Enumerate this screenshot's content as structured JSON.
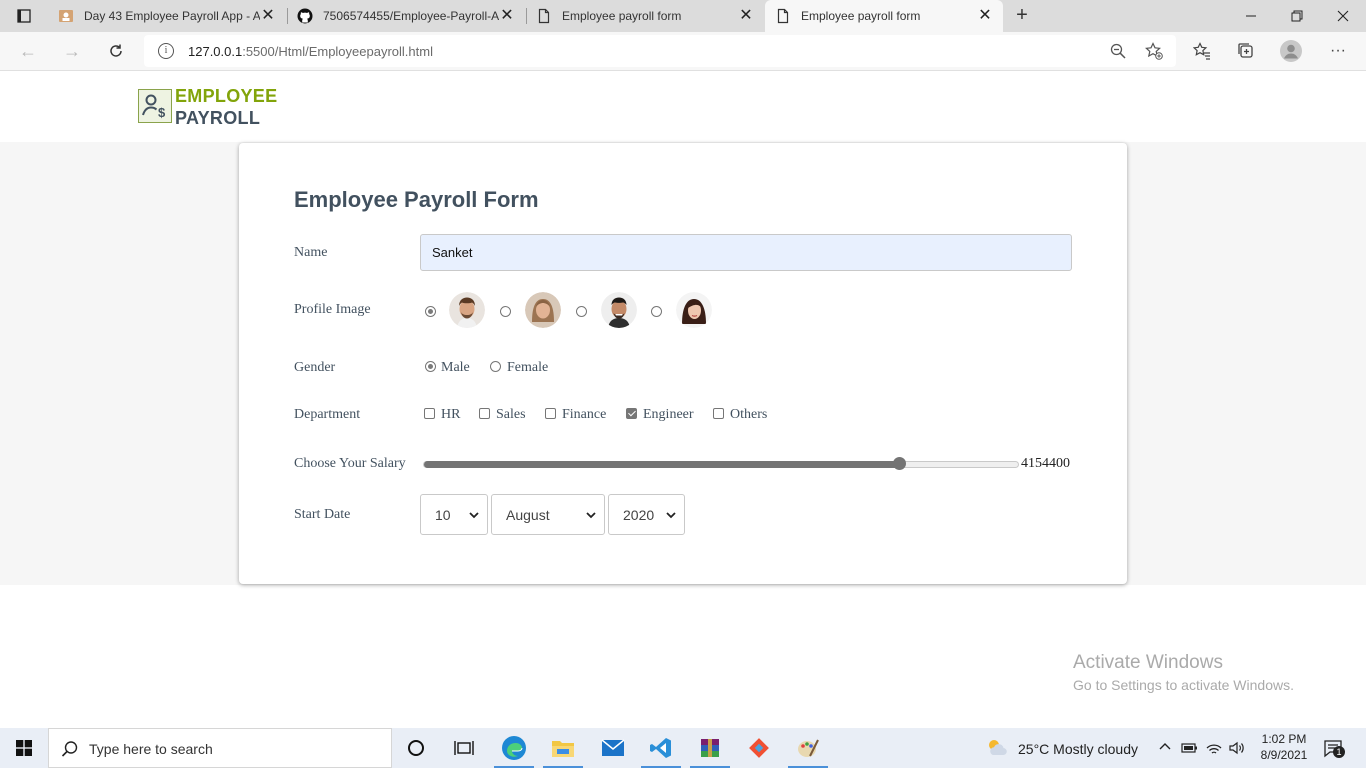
{
  "browser": {
    "tabs": [
      {
        "title": "Day 43 Employee Payroll App - A",
        "icon": "payroll-favicon"
      },
      {
        "title": "7506574455/Employee-Payroll-A",
        "icon": "github-icon"
      },
      {
        "title": "Employee payroll form",
        "icon": "page-icon"
      },
      {
        "title": "Employee payroll form",
        "icon": "page-icon",
        "active": true
      }
    ],
    "url_host": "127.0.0.1",
    "url_rest": ":5500/Html/Employeepayroll.html"
  },
  "header": {
    "logo_line1": "EMPLOYEE",
    "logo_line2": "PAYROLL"
  },
  "form": {
    "title": "Employee Payroll Form",
    "name_label": "Name",
    "name_value": "Sanket",
    "profile_label": "Profile Image",
    "profile_selected_index": 0,
    "gender_label": "Gender",
    "gender_options": [
      "Male",
      "Female"
    ],
    "gender_selected": "Male",
    "department_label": "Department",
    "departments": [
      "HR",
      "Sales",
      "Finance",
      "Engineer",
      "Others"
    ],
    "departments_checked": [
      "Engineer"
    ],
    "salary_label": "Choose Your Salary",
    "salary_value": "4154400",
    "salary_fraction": 0.8,
    "start_date_label": "Start Date",
    "day": "10",
    "month": "August",
    "year": "2020"
  },
  "watermark": {
    "line1": "Activate Windows",
    "line2": "Go to Settings to activate Windows."
  },
  "taskbar": {
    "search_placeholder": "Type here to search",
    "weather": "25°C  Mostly cloudy",
    "time": "1:02 PM",
    "date": "8/9/2021",
    "notification_count": "1"
  },
  "colors": {
    "logo_green": "#82a40a",
    "title_slate": "#42515f",
    "input_fill": "#e8f0fe"
  }
}
